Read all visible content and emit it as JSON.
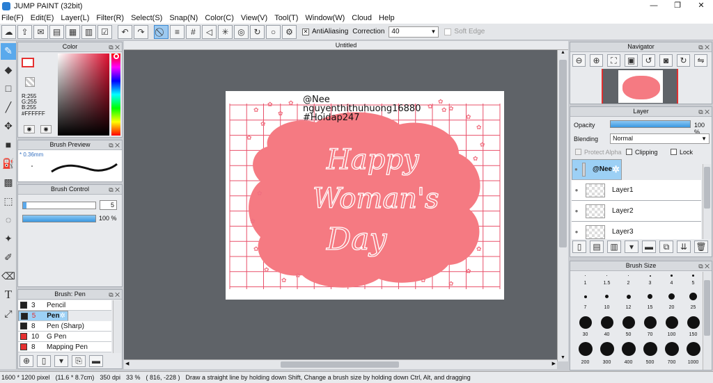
{
  "window": {
    "title": "JUMP PAINT (32bit)",
    "minimize": "—",
    "restore": "❐",
    "close": "✕"
  },
  "menu": [
    "File(F)",
    "Edit(E)",
    "Layer(L)",
    "Filter(R)",
    "Select(S)",
    "Snap(N)",
    "Color(C)",
    "View(V)",
    "Tool(T)",
    "Window(W)",
    "Cloud",
    "Help"
  ],
  "toolbar": {
    "antialiasing_label": "AntiAliasing",
    "correction_label": "Correction",
    "correction_value": "40",
    "soft_edge_label": "Soft Edge"
  },
  "color_panel": {
    "title": "Color",
    "r": "R:255",
    "g": "G:255",
    "b": "B:255",
    "hex": "#FFFFFF"
  },
  "brush_preview": {
    "title": "Brush Preview",
    "size": "* 0.36mm"
  },
  "brush_control": {
    "title": "Brush Control",
    "size_value": "5",
    "opacity_value": "100 %",
    "size_fraction": 0.05,
    "opacity_fraction": 1.0
  },
  "brush_list": {
    "title": "Brush: Pen",
    "items": [
      {
        "num": "3",
        "name": "Pencil",
        "color": "#222222"
      },
      {
        "num": "5",
        "name": "Pen",
        "color": "#222222",
        "selected": true
      },
      {
        "num": "8",
        "name": "Pen (Sharp)",
        "color": "#222222"
      },
      {
        "num": "10",
        "name": "G Pen",
        "color": "#e63030"
      },
      {
        "num": "8",
        "name": "Mapping Pen",
        "color": "#e63030"
      }
    ]
  },
  "document": {
    "tab": "Untitled"
  },
  "artwork": {
    "watermark_lines": [
      "@Nee",
      "nguyenthithuhuong16880",
      "#Hoidap247"
    ],
    "message_lines": [
      "Happy",
      "Woman's",
      "Day"
    ],
    "accent": "#f07080",
    "grid_color": "#e8506a"
  },
  "navigator": {
    "title": "Navigator"
  },
  "layer_panel": {
    "title": "Layer",
    "opacity_label": "Opacity",
    "opacity_value": "100 %",
    "blending_label": "Blending",
    "blending_value": "Normal",
    "protect_alpha_label": "Protect Alpha",
    "clipping_label": "Clipping",
    "lock_label": "Lock",
    "layers": [
      {
        "name": "@Nee",
        "selected": true
      },
      {
        "name": "Layer1"
      },
      {
        "name": "Layer2"
      },
      {
        "name": "Layer3"
      }
    ]
  },
  "brush_size": {
    "title": "Brush Size",
    "sizes": [
      "1",
      "1.5",
      "2",
      "3",
      "4",
      "5",
      "7",
      "10",
      "12",
      "15",
      "20",
      "25",
      "30",
      "40",
      "50",
      "70",
      "100",
      "150",
      "200",
      "300",
      "400",
      "500",
      "700",
      "1000"
    ]
  },
  "status": {
    "dims": "1600 * 1200 pixel",
    "physical": "(11.6 * 8.7cm)",
    "dpi": "350 dpi",
    "zoom": "33 %",
    "coords": "( 816, -228 )",
    "hint": "Draw a straight line by holding down Shift, Change a brush size by holding down Ctrl, Alt, and dragging"
  }
}
